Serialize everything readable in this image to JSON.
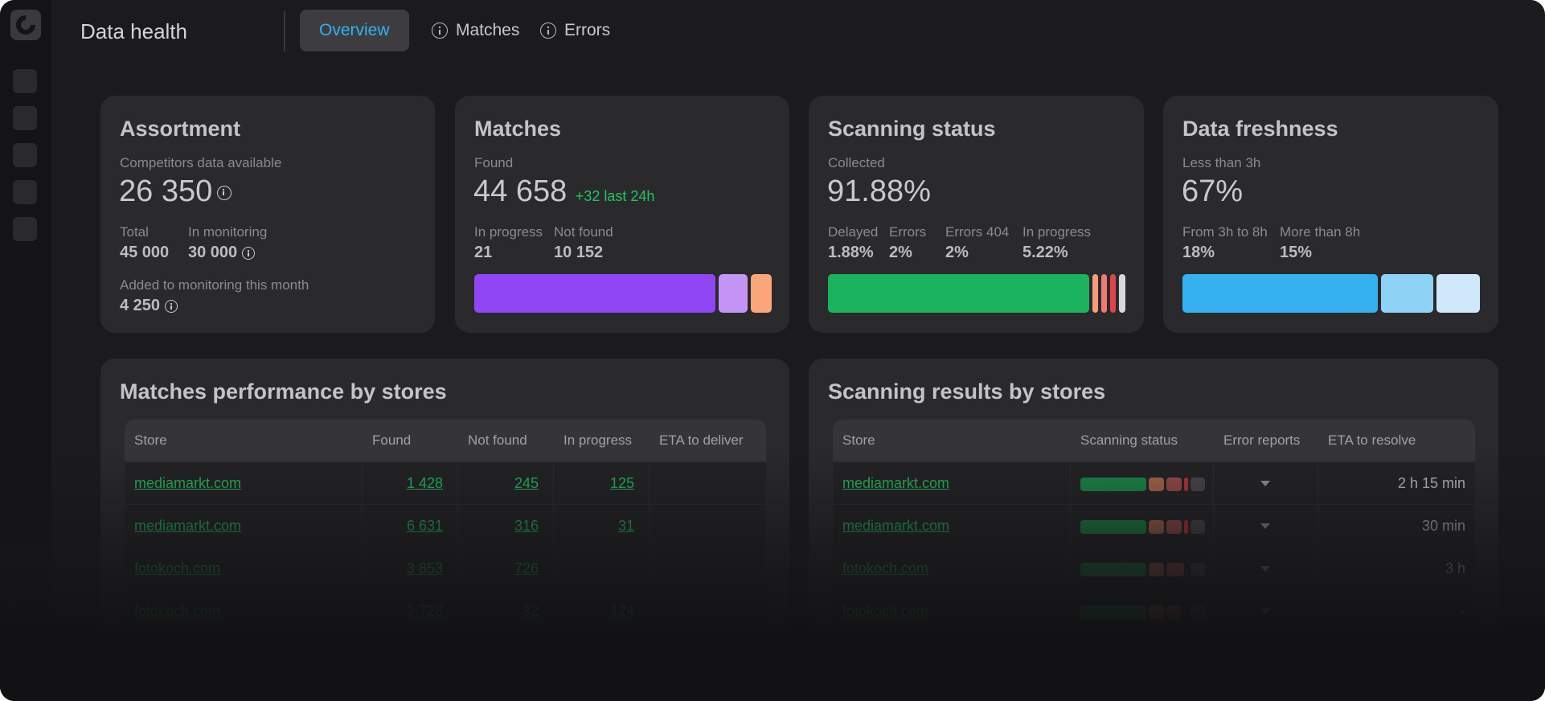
{
  "header": {
    "title": "Data health",
    "tabs": [
      {
        "label": "Overview",
        "active": true
      },
      {
        "label": "Matches",
        "icon": "info-icon"
      },
      {
        "label": "Errors",
        "icon": "info-icon"
      }
    ]
  },
  "assortment": {
    "title": "Assortment",
    "main_label": "Competitors data available",
    "main_value": "26 350",
    "total_label": "Total",
    "total_value": "45 000",
    "monitoring_label": "In monitoring",
    "monitoring_value": "30 000",
    "added_label": "Added to monitoring this month",
    "added_value": "4 250"
  },
  "matches": {
    "title": "Matches",
    "found_label": "Found",
    "found_value": "44 658",
    "delta": "+32 last 24h",
    "inprogress_label": "In progress",
    "inprogress_value": "21",
    "notfound_label": "Not found",
    "notfound_value": "10 152",
    "bar": [
      {
        "color": "#9146f5",
        "share": 0.83
      },
      {
        "color": "#c595f5",
        "share": 0.1
      },
      {
        "color": "#fba67a",
        "share": 0.07
      }
    ]
  },
  "scanning": {
    "title": "Scanning status",
    "collected_label": "Collected",
    "collected_value": "91.88%",
    "delayed_label": "Delayed",
    "delayed_value": "1.88%",
    "errors_label": "Errors",
    "errors_value": "2%",
    "errors404_label": "Errors 404",
    "errors404_value": "2%",
    "inprogress_label": "In progress",
    "inprogress_value": "5.22%",
    "bar": [
      {
        "color": "#1cb35e",
        "share": 0.9188
      },
      {
        "color": "#f99c7e",
        "share": 0.0188
      },
      {
        "color": "#ee7a72",
        "share": 0.02
      },
      {
        "color": "#e0434b",
        "share": 0.02
      },
      {
        "color": "#d8d9dd",
        "share": 0.0522
      }
    ]
  },
  "freshness": {
    "title": "Data freshness",
    "main_label": "Less than 3h",
    "main_value": "67%",
    "mid_label": "From 3h to 8h",
    "mid_value": "18%",
    "old_label": "More than 8h",
    "old_value": "15%",
    "bar": [
      {
        "color": "#35b1f0",
        "share": 0.67
      },
      {
        "color": "#8ed2f6",
        "share": 0.18
      },
      {
        "color": "#cfe9fb",
        "share": 0.15
      }
    ]
  },
  "matches_table": {
    "title": "Matches performance by stores",
    "columns": [
      "Store",
      "Found",
      "Not found",
      "In progress",
      "ETA to deliver"
    ],
    "rows": [
      {
        "store": "mediamarkt.com",
        "found": "1 428",
        "not_found": "245",
        "in_progress": "125",
        "eta": ""
      },
      {
        "store": "mediamarkt.com",
        "found": "6 631",
        "not_found": "316",
        "in_progress": "31",
        "eta": ""
      },
      {
        "store": "fotokoch.com",
        "found": "3 853",
        "not_found": "726",
        "in_progress": "",
        "eta": ""
      },
      {
        "store": "fotokoch.com",
        "found": "2 728",
        "not_found": "32",
        "in_progress": "124",
        "eta": ""
      }
    ]
  },
  "scanning_table": {
    "title": "Scanning results by stores",
    "columns": [
      "Store",
      "Scanning status",
      "Error reports",
      "ETA to resolve"
    ],
    "rows": [
      {
        "store": "mediamarkt.com",
        "eta": "2 h 15 min"
      },
      {
        "store": "mediamarkt.com",
        "eta": "30 min"
      },
      {
        "store": "fotokoch.com",
        "eta": "3 h"
      },
      {
        "store": "fotokoch.com",
        "eta": "-"
      }
    ]
  }
}
